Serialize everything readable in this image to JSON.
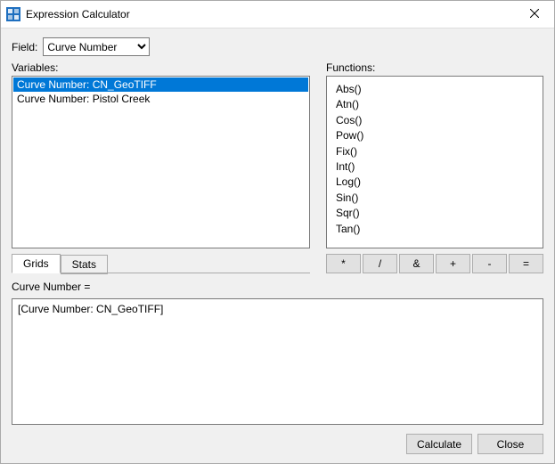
{
  "window": {
    "title": "Expression Calculator"
  },
  "field": {
    "label": "Field:",
    "selected": "Curve Number"
  },
  "variables": {
    "label": "Variables:",
    "items": [
      {
        "text": "Curve Number: CN_GeoTIFF",
        "selected": true
      },
      {
        "text": "Curve Number: Pistol Creek",
        "selected": false
      }
    ]
  },
  "functions": {
    "label": "Functions:",
    "items": [
      "Abs()",
      "Atn()",
      "Cos()",
      "Pow()",
      "Fix()",
      "Int()",
      "Log()",
      "Sin()",
      "Sqr()",
      "Tan()"
    ]
  },
  "tabs": {
    "items": [
      {
        "label": "Grids",
        "active": true
      },
      {
        "label": "Stats",
        "active": false
      }
    ]
  },
  "operators": {
    "items": [
      "*",
      "/",
      "&",
      "+",
      "-",
      "="
    ]
  },
  "expression": {
    "label": "Curve Number =",
    "value": "[Curve Number: CN_GeoTIFF]"
  },
  "buttons": {
    "calculate": "Calculate",
    "close": "Close"
  }
}
